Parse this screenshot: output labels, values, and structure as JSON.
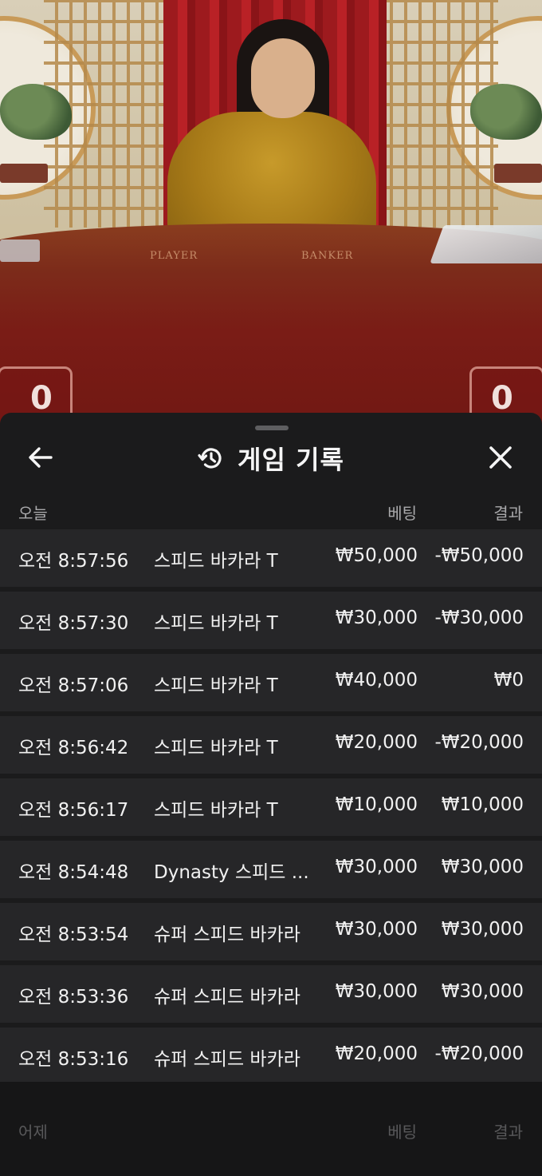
{
  "video": {
    "player_label": "PLAYER",
    "banker_label": "BANKER",
    "player_score": "0",
    "banker_score": "0"
  },
  "sheet": {
    "title": "게임 기록",
    "today_section": {
      "label": "오늘",
      "bet_header": "베팅",
      "result_header": "결과"
    },
    "rows": [
      {
        "time": "오전 8:57:56",
        "game": "스피드 바카라 T",
        "bet": "₩50,000",
        "result": "-₩50,000"
      },
      {
        "time": "오전 8:57:30",
        "game": "스피드 바카라 T",
        "bet": "₩30,000",
        "result": "-₩30,000"
      },
      {
        "time": "오전 8:57:06",
        "game": "스피드 바카라 T",
        "bet": "₩40,000",
        "result": "₩0"
      },
      {
        "time": "오전 8:56:42",
        "game": "스피드 바카라 T",
        "bet": "₩20,000",
        "result": "-₩20,000"
      },
      {
        "time": "오전 8:56:17",
        "game": "스피드 바카라 T",
        "bet": "₩10,000",
        "result": "₩10,000"
      },
      {
        "time": "오전 8:54:48",
        "game": "Dynasty 스피드 ...",
        "bet": "₩30,000",
        "result": "₩30,000"
      },
      {
        "time": "오전 8:53:54",
        "game": "슈퍼 스피드 바카라",
        "bet": "₩30,000",
        "result": "₩30,000"
      },
      {
        "time": "오전 8:53:36",
        "game": "슈퍼 스피드 바카라",
        "bet": "₩30,000",
        "result": "₩30,000"
      },
      {
        "time": "오전 8:53:16",
        "game": "슈퍼 스피드 바카라",
        "bet": "₩20,000",
        "result": "-₩20,000"
      }
    ],
    "yesterday_section": {
      "label": "어제",
      "bet_header": "베팅",
      "result_header": "결과"
    }
  },
  "icons": {
    "back": "arrow-left-icon",
    "history": "history-clock-icon",
    "close": "close-x-icon"
  },
  "colors": {
    "sheet_bg": "#1b1b1c",
    "row_bg": "#262628",
    "text": "#f1f1f1",
    "muted": "#a9a9ab"
  }
}
